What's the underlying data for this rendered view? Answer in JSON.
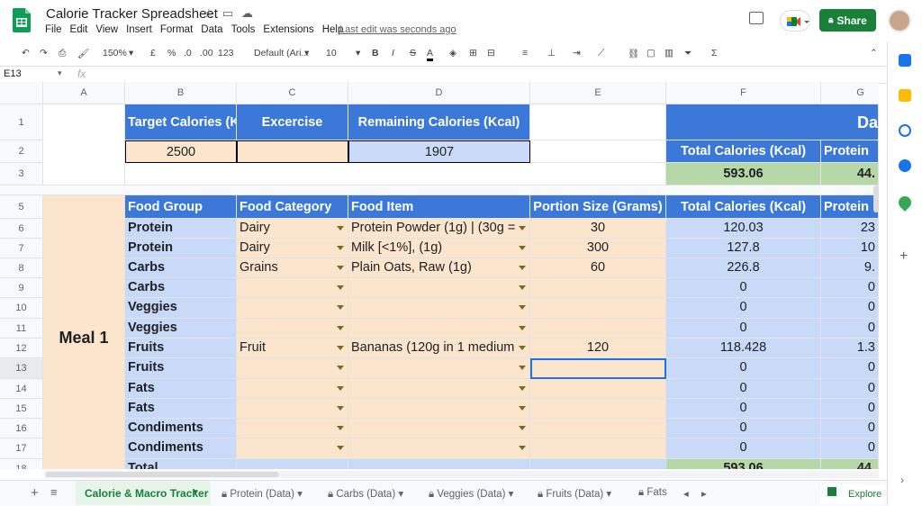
{
  "app": {
    "title": "Calorie Tracker Spreadsheet",
    "menu": [
      "File",
      "Edit",
      "View",
      "Insert",
      "Format",
      "Data",
      "Tools",
      "Extensions",
      "Help"
    ],
    "last_edit": "Last edit was seconds ago",
    "share_label": "Share",
    "accent": "#188038"
  },
  "toolbar": {
    "zoom": "150%",
    "currency": "£",
    "percent": "%",
    "dec_decrease": ".0",
    "dec_increase": ".00",
    "format_more": "123",
    "font": "Default (Ari...",
    "font_size": "10",
    "bold": "B",
    "italic": "I",
    "strike": "S",
    "text_color": "A"
  },
  "formula_bar": {
    "name_box": "E13",
    "fx": "fx"
  },
  "columns": [
    "A",
    "B",
    "C",
    "D",
    "E",
    "F",
    "G"
  ],
  "rows": [
    "1",
    "2",
    "3",
    "5",
    "6",
    "7",
    "8",
    "9",
    "10",
    "11",
    "12",
    "13",
    "14",
    "15",
    "16",
    "17",
    "18"
  ],
  "summary": {
    "target_label": "Target Calories (Kcal)",
    "exercise_label": "Excercise",
    "remaining_label": "Remaining Calories (Kcal)",
    "target_value": "2500",
    "exercise_value": "",
    "remaining_value": "1907",
    "daily_header": "Da",
    "total_cal_label": "Total Calories (Kcal)",
    "protein_label": "Protein",
    "total_cal_value": "593.06",
    "protein_value": "44."
  },
  "table": {
    "headers": [
      "Food Group",
      "Food Category",
      "Food Item",
      "Portion Size (Grams)",
      "Total Calories (Kcal)",
      "Protein"
    ],
    "meal_label": "Meal 1",
    "rows": [
      {
        "group": "Protein",
        "category": "Dairy",
        "item": "Protein Powder (1g) | (30g =",
        "portion": "30",
        "calories": "120.03",
        "protein": "23"
      },
      {
        "group": "Protein",
        "category": "Dairy",
        "item": "Milk [<1%], (1g)",
        "portion": "300",
        "calories": "127.8",
        "protein": "10"
      },
      {
        "group": "Carbs",
        "category": "Grains",
        "item": "Plain Oats, Raw (1g)",
        "portion": "60",
        "calories": "226.8",
        "protein": "9."
      },
      {
        "group": "Carbs",
        "category": "",
        "item": "",
        "portion": "",
        "calories": "0",
        "protein": "0"
      },
      {
        "group": "Veggies",
        "category": "",
        "item": "",
        "portion": "",
        "calories": "0",
        "protein": "0"
      },
      {
        "group": "Veggies",
        "category": "",
        "item": "",
        "portion": "",
        "calories": "0",
        "protein": "0"
      },
      {
        "group": "Fruits",
        "category": "Fruit",
        "item": "Bananas (120g in 1 medium",
        "portion": "120",
        "calories": "118.428",
        "protein": "1.3"
      },
      {
        "group": "Fruits",
        "category": "",
        "item": "",
        "portion": "",
        "calories": "0",
        "protein": "0"
      },
      {
        "group": "Fats",
        "category": "",
        "item": "",
        "portion": "",
        "calories": "0",
        "protein": "0"
      },
      {
        "group": "Fats",
        "category": "",
        "item": "",
        "portion": "",
        "calories": "0",
        "protein": "0"
      },
      {
        "group": "Condiments",
        "category": "",
        "item": "",
        "portion": "",
        "calories": "0",
        "protein": "0"
      },
      {
        "group": "Condiments",
        "category": "",
        "item": "",
        "portion": "",
        "calories": "0",
        "protein": "0"
      }
    ],
    "total_label": "Total",
    "total_calories": "593.06",
    "total_protein": "44."
  },
  "tabs": [
    {
      "label": "Calorie & Macro Tracker",
      "active": true
    },
    {
      "label": "Protein (Data)"
    },
    {
      "label": "Carbs (Data)"
    },
    {
      "label": "Veggies (Data)"
    },
    {
      "label": "Fruits (Data)"
    },
    {
      "label": "Fats"
    }
  ],
  "explore_label": "Explore",
  "colors": {
    "header_blue": "#3c78d8",
    "light_blue": "#c9daf8",
    "peach": "#fce5cd",
    "green": "#b6d7a8"
  }
}
